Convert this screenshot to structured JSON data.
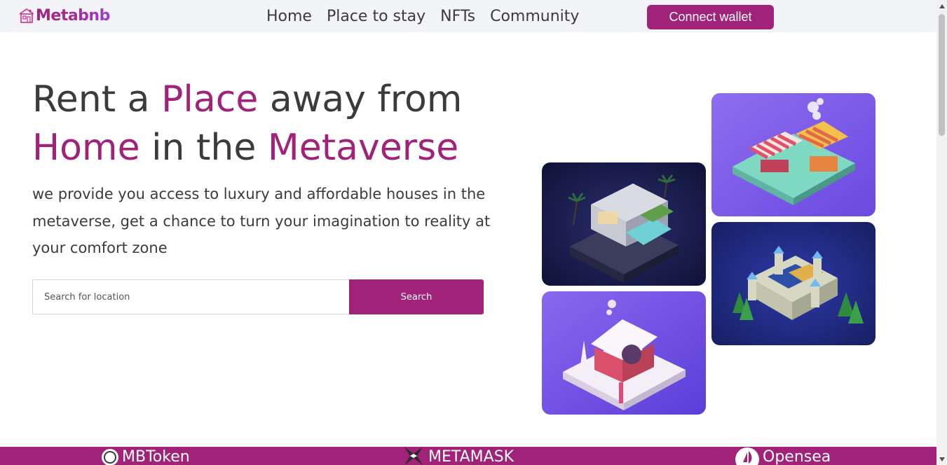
{
  "header": {
    "logo_text": "Metabnb",
    "nav": [
      {
        "label": "Home"
      },
      {
        "label": "Place to stay"
      },
      {
        "label": "NFTs"
      },
      {
        "label": "Community"
      }
    ],
    "connect_label": "Connect wallet"
  },
  "hero": {
    "headline_parts": [
      "Rent a ",
      "Place",
      " away from",
      "Home",
      " in the ",
      "Metaverse"
    ],
    "description": "we provide you access to luxury and affordable houses in the metaverse, get a chance to turn your imagination to reality at your comfort zone",
    "search": {
      "placeholder": "Search for location",
      "button_label": "Search"
    }
  },
  "tiles": [
    {
      "icon": "villa-illustration"
    },
    {
      "icon": "market-stall-illustration"
    },
    {
      "icon": "castle-illustration"
    },
    {
      "icon": "snow-cottage-illustration"
    }
  ],
  "partners": [
    {
      "label": "MBToken",
      "icon": "mbtoken-logo-icon"
    },
    {
      "label": "METAMASK",
      "icon": "metamask-logo-icon"
    },
    {
      "label": "Opensea",
      "icon": "opensea-logo-icon"
    }
  ],
  "colors": {
    "brand": "#a02279",
    "text": "#3b3b3b",
    "header_bg": "#f2f4f8"
  }
}
